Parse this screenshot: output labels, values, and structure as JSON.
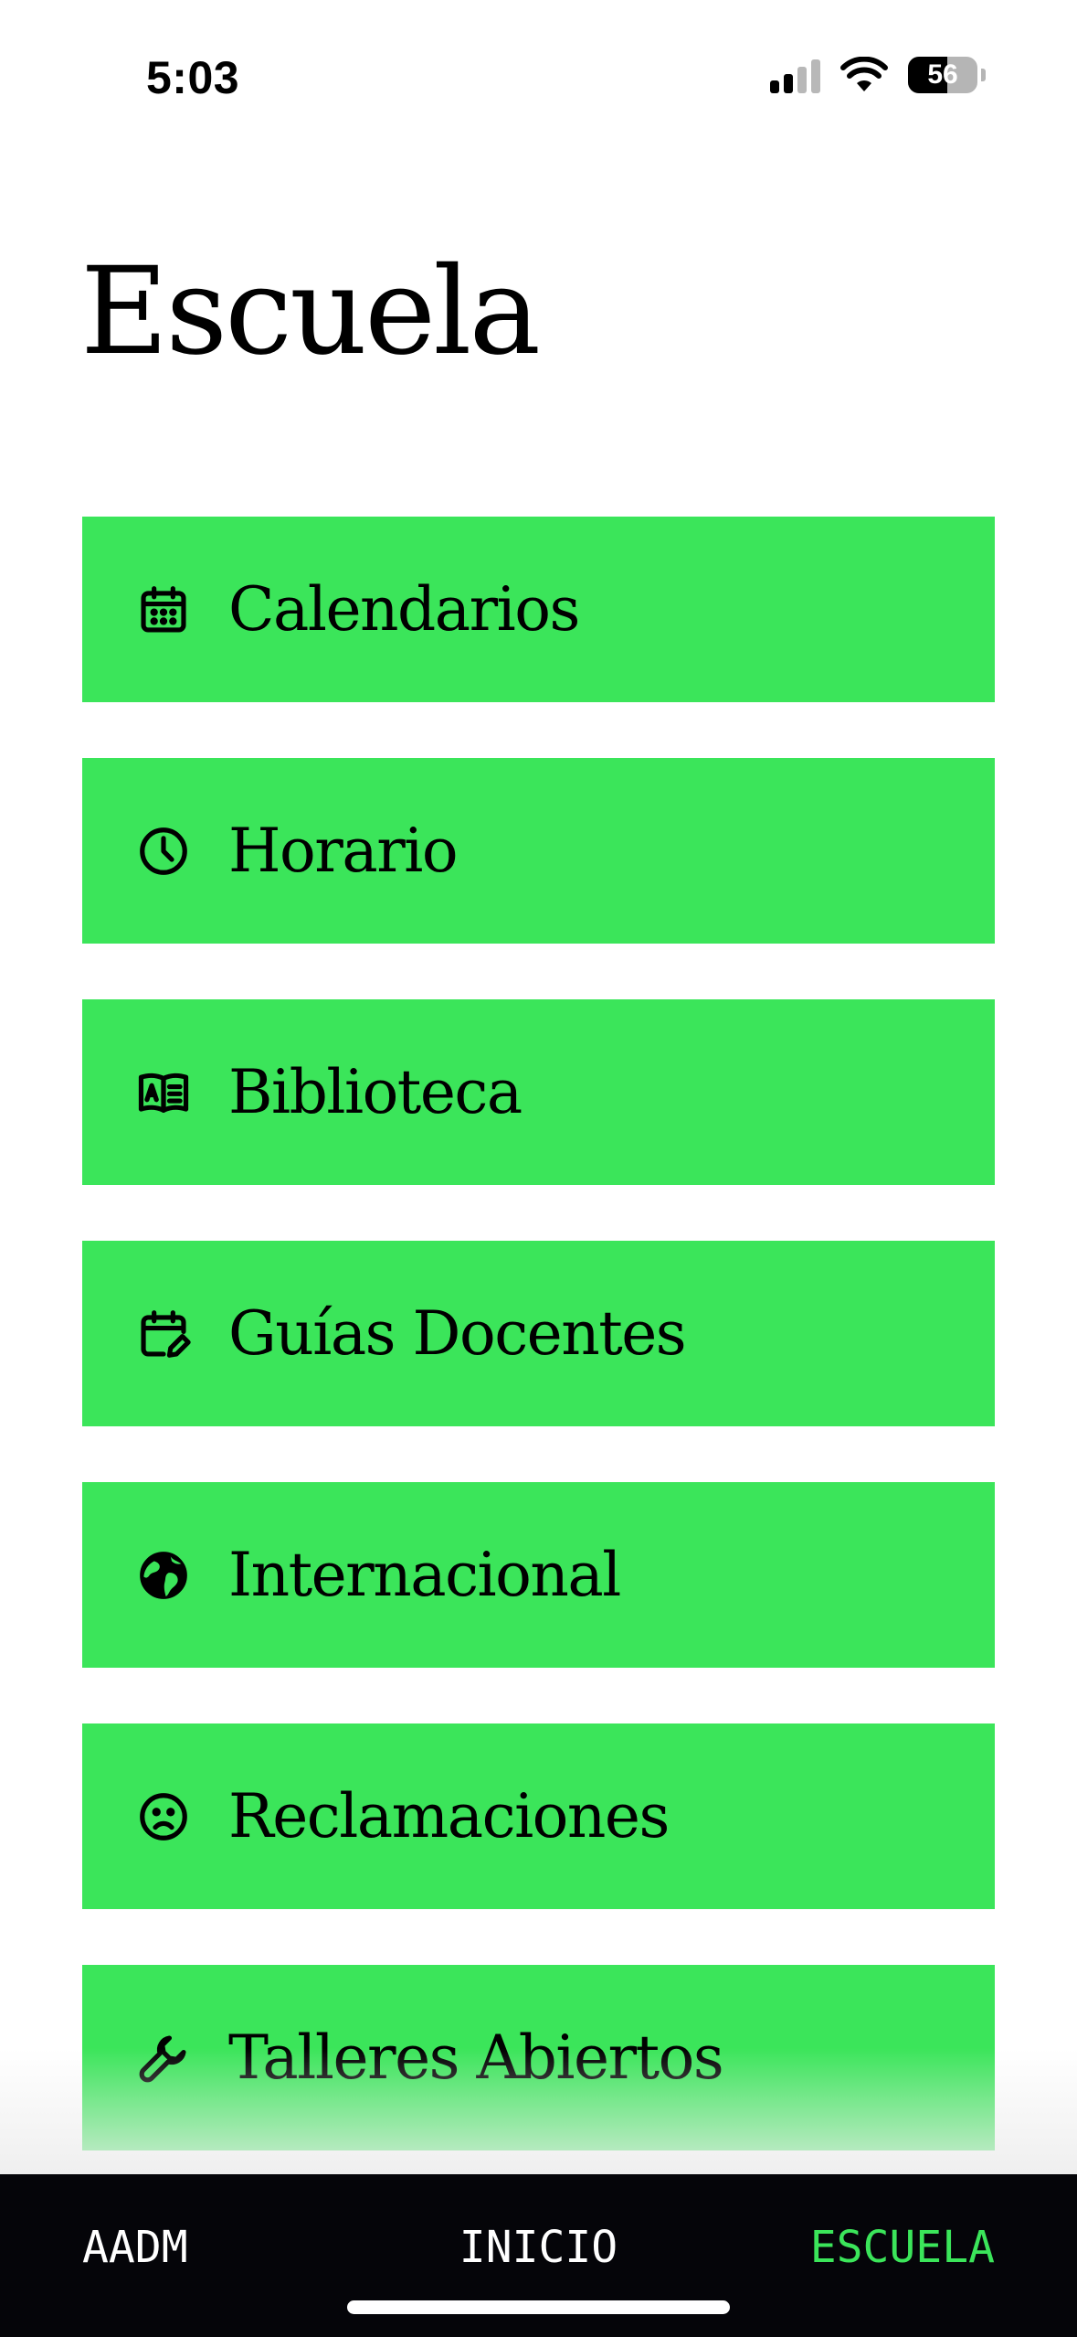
{
  "status_bar": {
    "time": "5:03",
    "battery_level": "56",
    "icons": [
      "signal-icon",
      "wifi-icon",
      "battery-icon"
    ]
  },
  "page": {
    "title": "Escuela"
  },
  "menu": {
    "items": [
      {
        "label": "Calendarios",
        "icon": "calendar-icon"
      },
      {
        "label": "Horario",
        "icon": "clock-icon"
      },
      {
        "label": "Biblioteca",
        "icon": "book-icon"
      },
      {
        "label": "Guías Docentes",
        "icon": "calendar-edit-icon"
      },
      {
        "label": "Internacional",
        "icon": "globe-icon"
      },
      {
        "label": "Reclamaciones",
        "icon": "sad-face-icon"
      },
      {
        "label": "Talleres Abiertos",
        "icon": "wrench-icon"
      }
    ]
  },
  "tab_bar": {
    "tabs": [
      {
        "label": "AADM",
        "active": false
      },
      {
        "label": "INICIO",
        "active": false
      },
      {
        "label": "ESCUELA",
        "active": true
      }
    ]
  },
  "colors": {
    "accent": "#3be55a",
    "tab_bar_background": "#050509",
    "background": "#ffffff"
  }
}
